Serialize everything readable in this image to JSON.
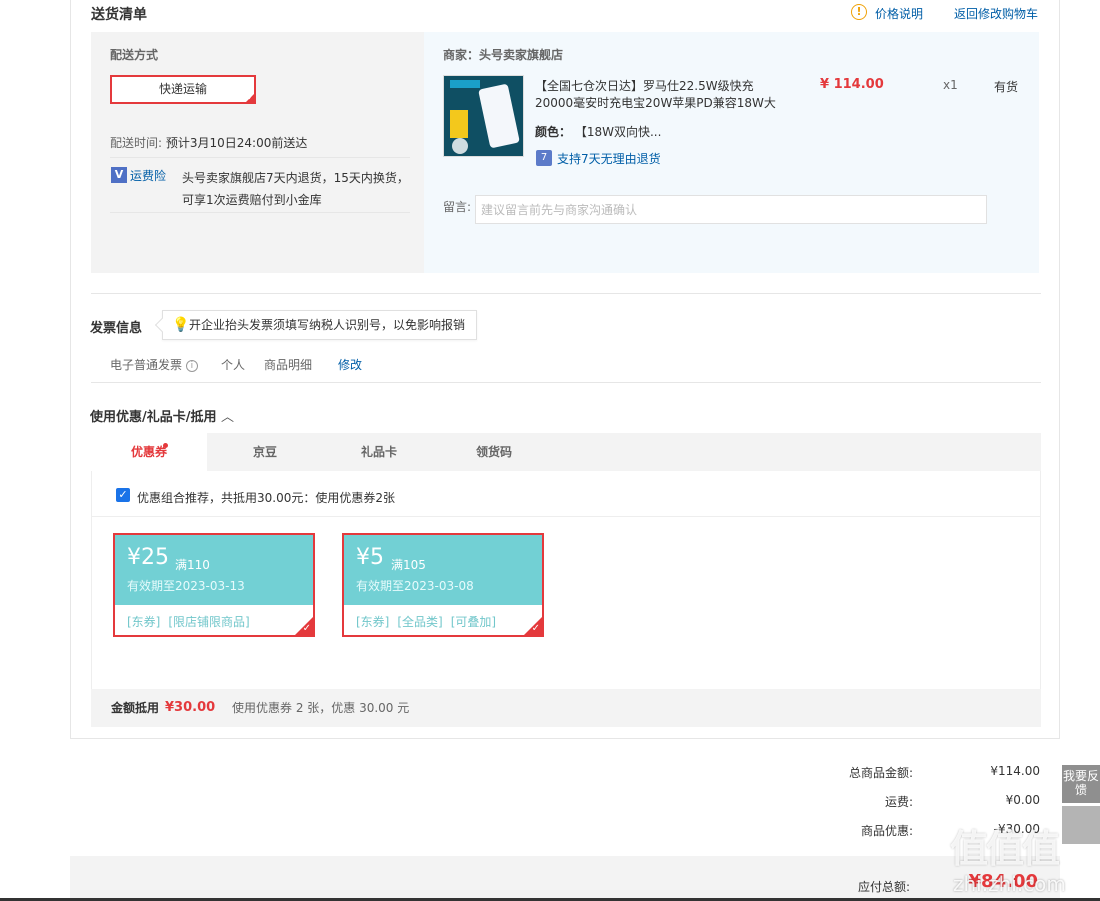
{
  "delivery": {
    "title": "送货清单",
    "price_note": "价格说明",
    "back_to_cart": "返回修改购物车",
    "method_label": "配送方式",
    "method_button": "快递运输",
    "time_label": "配送时间:",
    "time_value": "预计3月10日24:00前送达",
    "insurance_icon": "V",
    "insurance_label": "运费险",
    "insurance_text_1": "头号卖家旗舰店7天内退货，15天内换货，",
    "insurance_text_2": "可享1次运费赔付到小金库"
  },
  "shop": {
    "label": "商家：头号卖家旗舰店",
    "product_title_1": "【全国七仓次日达】罗马仕22.5W级快充",
    "product_title_2": "20000毫安时充电宝20W苹果PD兼容18W大",
    "price": "¥ 114.00",
    "quantity": "x1",
    "stock": "有货",
    "color_label": "颜色：",
    "color_value": "【18W双向快...",
    "return_policy": "支持7天无理由退货",
    "message_label": "留言:",
    "message_placeholder": "建议留言前先与商家沟通确认"
  },
  "invoice": {
    "title": "发票信息",
    "tip": "开企业抬头发票须填写纳税人识别号，以免影响报销",
    "type": "电子普通发票",
    "holder": "个人",
    "content": "商品明细",
    "edit": "修改"
  },
  "discount": {
    "title": "使用优惠/礼品卡/抵用",
    "tabs": [
      {
        "label": "优惠券"
      },
      {
        "label": "京豆"
      },
      {
        "label": "礼品卡"
      },
      {
        "label": "领货码"
      }
    ],
    "recommend_text": "优惠组合推荐，共抵用30.00元：使用优惠券2张",
    "coupons": [
      {
        "amount": "¥25",
        "cond": "满110",
        "expiry": "有效期至2023-03-13",
        "tags": [
          "[东券]",
          "[限店铺限商品]"
        ]
      },
      {
        "amount": "¥5",
        "cond": "满105",
        "expiry": "有效期至2023-03-08",
        "tags": [
          "[东券]",
          "[全品类]",
          "[可叠加]"
        ]
      }
    ],
    "summary_label": "金额抵用",
    "summary_amount": "¥30.00",
    "summary_text": "使用优惠券 2 张，优惠 30.00 元"
  },
  "totals": {
    "goods_label": "总商品金额:",
    "goods_value": "¥114.00",
    "freight_label": "运费:",
    "freight_value": "¥0.00",
    "discount_label": "商品优惠:",
    "discount_value": "-¥30.00",
    "payable_label": "应付总额:",
    "payable_value": "¥84.00"
  },
  "side": {
    "feedback": "我要反馈"
  },
  "watermark": {
    "big": "值值值",
    "small": "zhi.zhi.com"
  },
  "colors": {
    "accent_red": "#e4393c",
    "link_blue": "#005ea7",
    "coupon_teal": "#72d0d4"
  }
}
